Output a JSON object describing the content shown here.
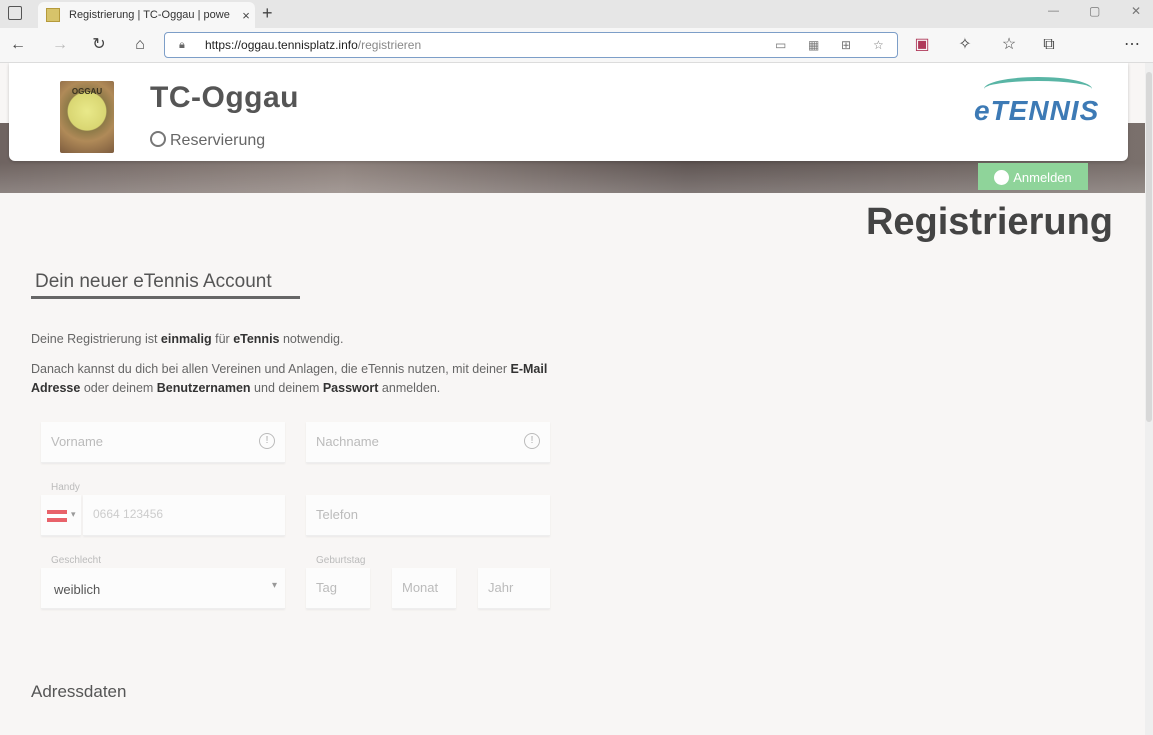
{
  "browser": {
    "tab_title": "Registrierung | TC-Oggau | powe",
    "tab_close": "×",
    "new_tab": "+",
    "url_host": "https://oggau.tennisplatz.info",
    "url_path": "/registrieren",
    "window_controls": [
      "—",
      "▢",
      "✕"
    ]
  },
  "header": {
    "logo_text": "OGGAU",
    "club_name": "TC-Oggau",
    "subtitle": "Reservierung",
    "brand": "eTENNIS",
    "login_label": "Anmelden"
  },
  "main": {
    "page_title": "Registrierung",
    "section_account": "Dein neuer eTennis Account",
    "intro": {
      "p1_a": "Deine Registrierung ist ",
      "p1_b": "einmalig",
      "p1_c": " für ",
      "p1_d": "eTennis",
      "p1_e": " notwendig.",
      "p2_a": "Danach kannst du dich bei allen Vereinen und Anlagen, die eTennis nutzen, mit deiner ",
      "p2_b": "E-Mail",
      "p2_c": "Adresse",
      "p2_d": " oder deinem ",
      "p2_e": "Benutzernamen",
      "p2_f": " und deinem ",
      "p2_g": "Passwort",
      "p2_h": " anmelden."
    },
    "form": {
      "vorname_placeholder": "Vorname",
      "nachname_placeholder": "Nachname",
      "handy_label": "Handy",
      "handy_placeholder": "0664 123456",
      "telefon_placeholder": "Telefon",
      "geschlecht_label": "Geschlecht",
      "geschlecht_value": "weiblich",
      "geburtstag_label": "Geburtstag",
      "tag_placeholder": "Tag",
      "monat_placeholder": "Monat",
      "jahr_placeholder": "Jahr"
    },
    "section_address": "Adressdaten"
  },
  "colors": {
    "login_button": "#8fd49a",
    "brand_blue": "#3d7ab5",
    "address_focus": "#7d9ec8"
  }
}
